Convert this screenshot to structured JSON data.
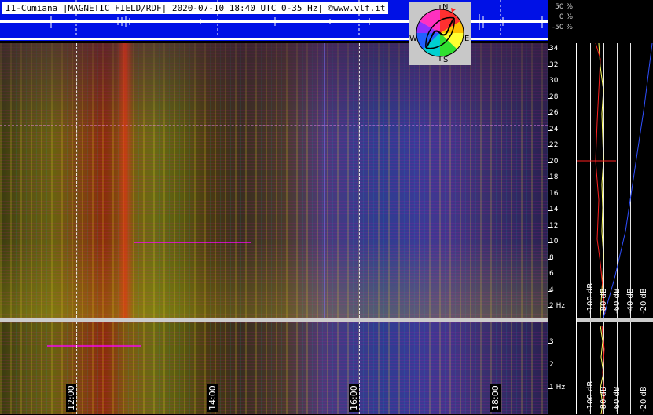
{
  "header": {
    "title": "I1-Cumiana |MAGNETIC FIELD/RDF| 2020-07-10 18:40 UTC 0-35 Hz| ©www.vlf.it"
  },
  "amplitude_scale": [
    "50 %",
    "0 %",
    "-50 %"
  ],
  "compass": {
    "n": "N",
    "s": "S",
    "e": "E",
    "w": "W"
  },
  "frequency_axis_upper": [
    "34",
    "32",
    "30",
    "28",
    "26",
    "24",
    "22",
    "20",
    "18",
    "16",
    "14",
    "12",
    "10",
    "8",
    "6",
    "4",
    "2 Hz"
  ],
  "frequency_axis_lower": [
    "3",
    "2",
    "1 Hz"
  ],
  "time_axis": [
    "12:00",
    "14:00",
    "16:00",
    "18:00"
  ],
  "db_scale": [
    "-100 dB",
    "-80 dB",
    "-60 dB",
    "-40 dB",
    "-20 dB"
  ],
  "colors": {
    "strip_blue": "#0011e6",
    "grid": "#ffffff",
    "trace_red": "#ff2020",
    "trace_yellow": "#ffff60",
    "trace_blue": "#3050ff"
  }
}
